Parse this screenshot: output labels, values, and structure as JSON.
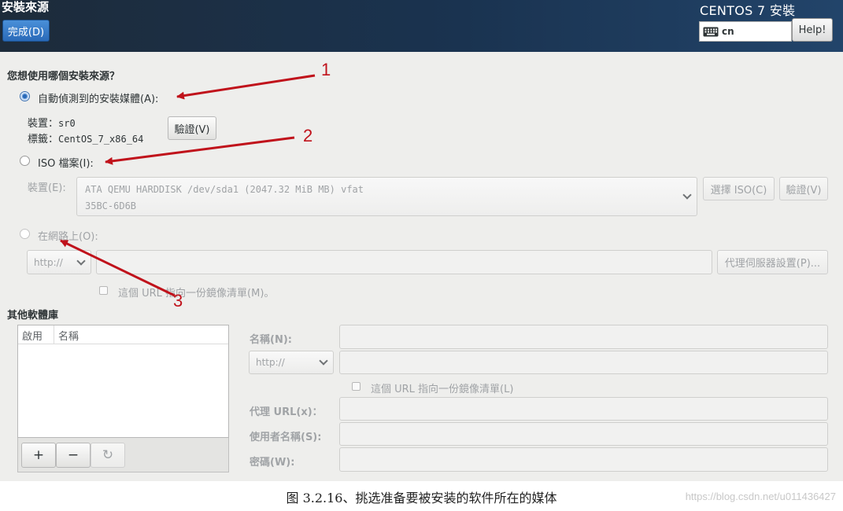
{
  "header": {
    "spoke_title": "安裝來源",
    "done_button": "完成(D)",
    "product_title": "CENTOS 7 安裝",
    "keyboard_layout": "cn",
    "help_button": "Help!"
  },
  "source": {
    "question": "您想使用哪個安裝來源？",
    "auto_option": "自動偵測到的安裝媒體(A):",
    "device_label": "裝置：",
    "device_value": "sr0",
    "tag_label": "標籤：",
    "tag_value": "CentOS_7_x86_64",
    "verify_button": "驗證(V)",
    "iso_option": "ISO 檔案(I):",
    "iso_device_label": "裝置(E):",
    "iso_device_line1": "ATA QEMU HARDDISK /dev/sda1 (2047.32 MiB MB) vfat",
    "iso_device_line2": "35BC-6D6B",
    "choose_iso_button": "選擇 ISO(C)",
    "iso_verify_button": "驗證(V)",
    "network_option": "在網路上(O):",
    "protocol_value": "http://",
    "proxy_button": "代理伺服器設置(P)...",
    "mirrorlist_check": "這個 URL 指向一份鏡像清單(M)。"
  },
  "repos": {
    "heading": "其他軟體庫",
    "columns": [
      "啟用",
      "名稱"
    ],
    "add_label": "+",
    "remove_label": "−",
    "refresh_label": "↻",
    "name_label": "名稱(N):",
    "protocol_value": "http://",
    "mirrorlist_check": "這個 URL 指向一份鏡像清單(L)",
    "proxy_url_label": "代理 URL(x)：",
    "username_label": "使用者名稱(S):",
    "password_label": "密碼(W):"
  },
  "annotations": [
    "1",
    "2",
    "3"
  ],
  "annotation_color": "#c0121b",
  "caption": "图 3.2.16、挑选准备要被安装的软件所在的媒体",
  "watermark": "https://blog.csdn.net/u011436427"
}
